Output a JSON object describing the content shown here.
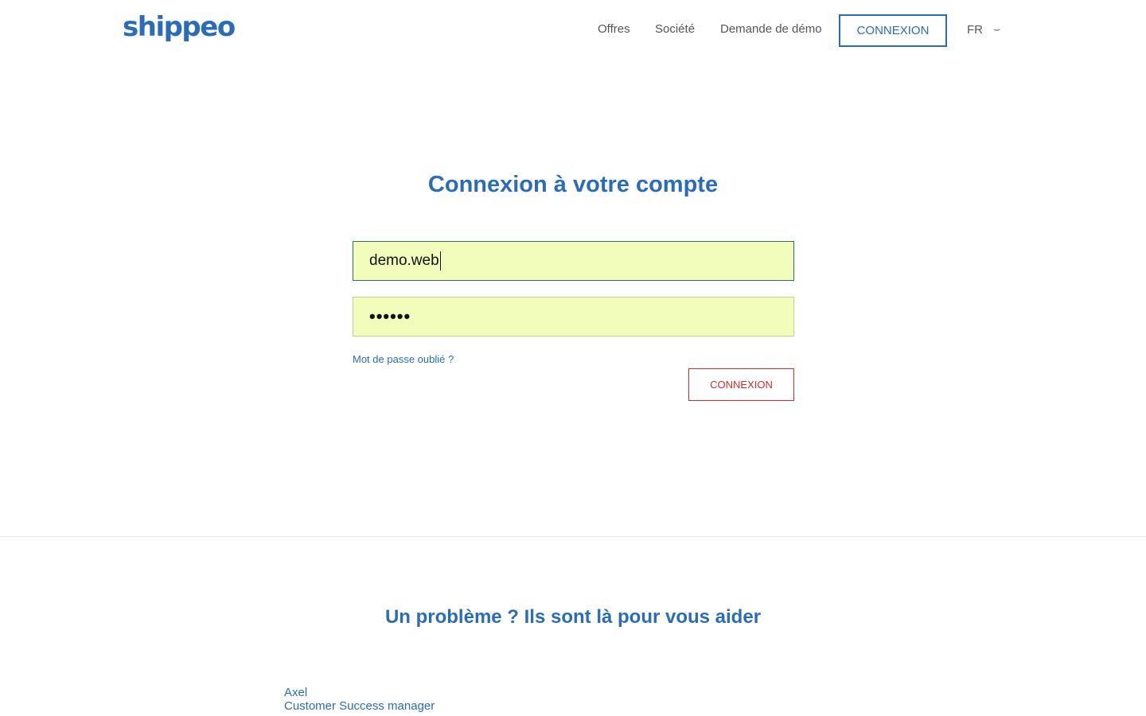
{
  "header": {
    "logo": "shippeo",
    "nav": {
      "offres": "Offres",
      "societe": "Société",
      "demo": "Demande de démo",
      "connexion": "CONNEXION"
    },
    "language": "FR",
    "language_chevron": "⌣"
  },
  "login": {
    "title": "Connexion à votre compte",
    "username_value": "demo.web",
    "password_value": "••••••",
    "forgot_label": "Mot de passe oublié ?",
    "submit_label": "CONNEXION"
  },
  "help": {
    "title": "Un problème ? Ils sont là pour vous aider",
    "contact_name": "Axel",
    "contact_role": "Customer Success manager"
  },
  "colors": {
    "brand_blue": "#2b6cb8",
    "autofill_yellow": "#f2fdbb",
    "submit_red": "#d42a2a"
  }
}
